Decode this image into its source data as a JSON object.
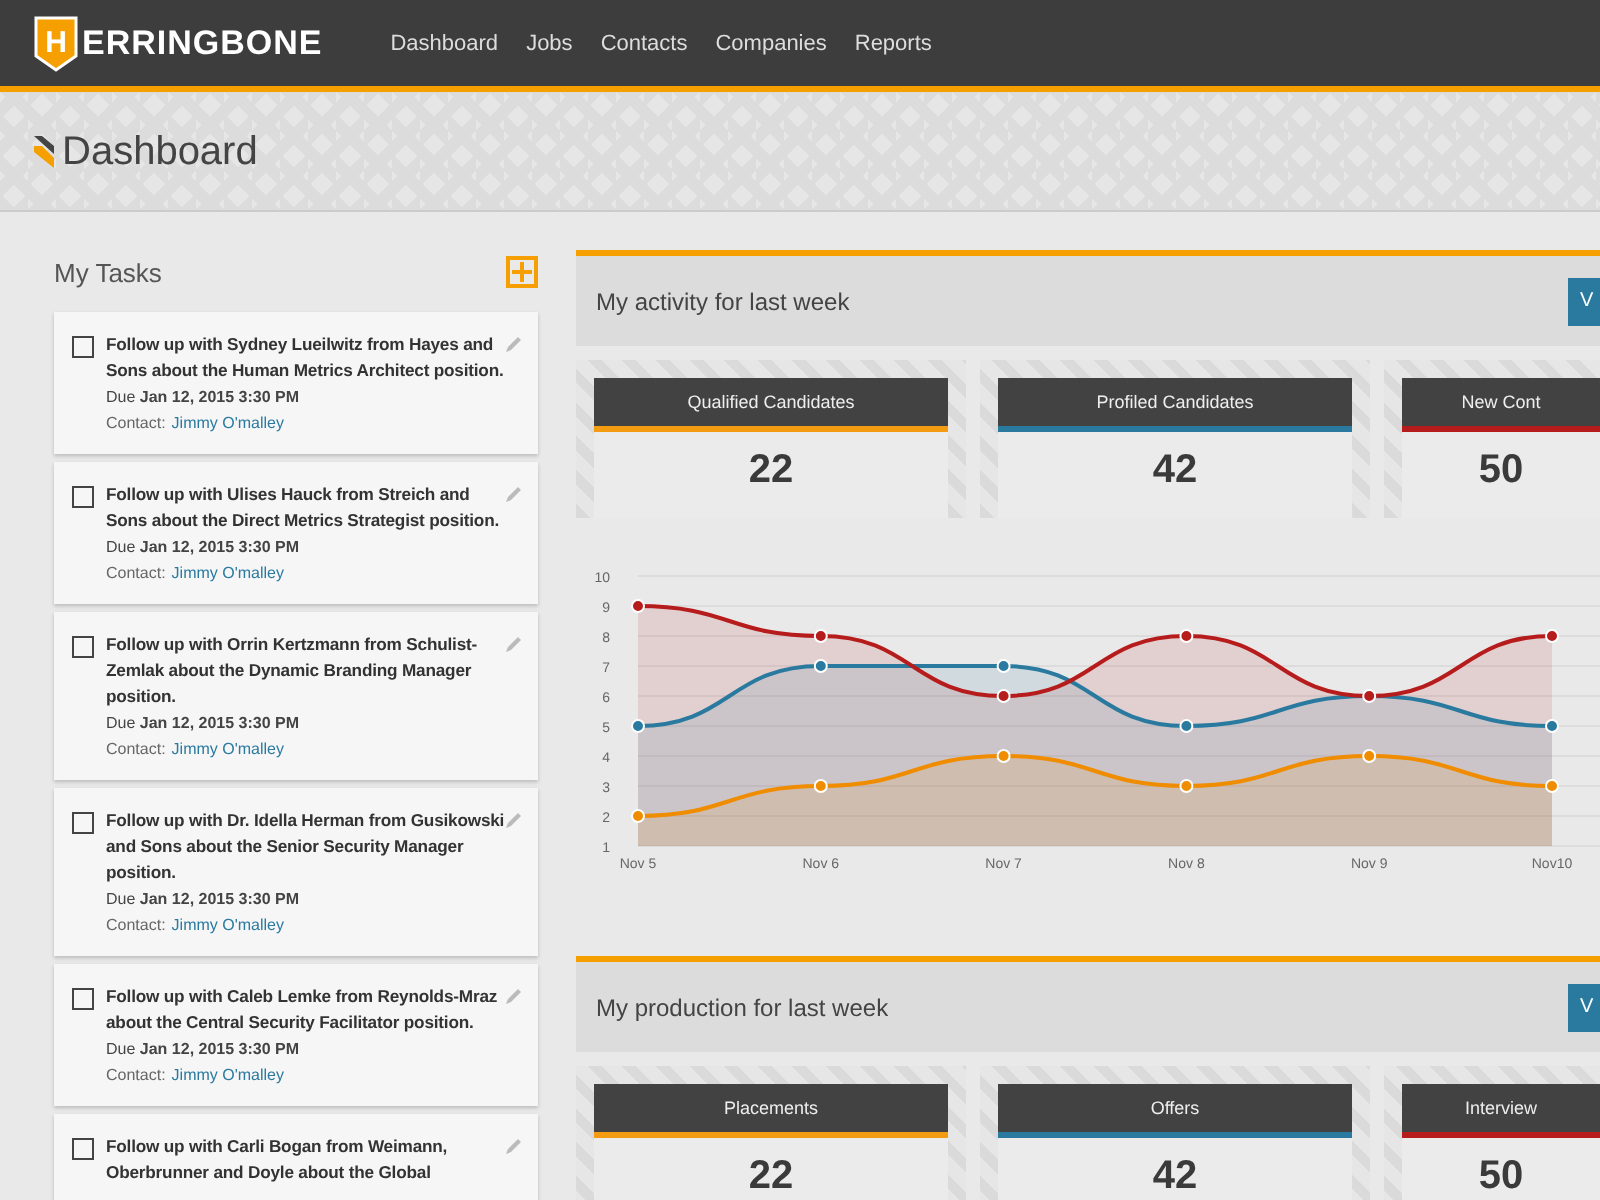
{
  "logo": {
    "mark": "H",
    "text": "ERRINGBONE"
  },
  "nav": [
    {
      "label": "Dashboard"
    },
    {
      "label": "Jobs"
    },
    {
      "label": "Contacts"
    },
    {
      "label": "Companies"
    },
    {
      "label": "Reports"
    }
  ],
  "page_title": "Dashboard",
  "tasks_panel": {
    "title": "My Tasks",
    "tasks": [
      {
        "text": "Follow up with Sydney Lueilwitz from Hayes and Sons about the Human Metrics Architect position.",
        "due": "Due **Jan 12, 2015 3:30 PM**",
        "contact_label": "Contact:",
        "contact": "Jimmy O'malley",
        "checked": false
      },
      {
        "text": "Follow up with Ulises Hauck from Streich and Sons about the Direct Metrics Strategist position.",
        "due": "Due **Jan 12, 2015 3:30 PM**",
        "contact_label": "Contact:",
        "contact": "Jimmy O'malley",
        "checked": false
      },
      {
        "text": "Follow up with Orrin Kertzmann from Schulist-Zemlak about the Dynamic Branding Manager position.",
        "due": "Due **Jan 12, 2015 3:30 PM**",
        "contact_label": "Contact:",
        "contact": "Jimmy O'malley",
        "checked": false
      },
      {
        "text": "Follow up with Dr. Idella Herman from Gusikowski and Sons about the Senior Security Manager position.",
        "due": "Due **Jan 12, 2015 3:30 PM**",
        "contact_label": "Contact:",
        "contact": "Jimmy O'malley",
        "checked": false
      },
      {
        "text": "Follow up with Caleb Lemke from Reynolds-Mraz about the Central Security Facilitator position.",
        "due": "Due **Jan 12, 2015 3:30 PM**",
        "contact_label": "Contact:",
        "contact": "Jimmy O'malley",
        "checked": false
      },
      {
        "text": "Follow up with Carli Bogan from Weimann, Oberbrunner and Doyle about the Global",
        "checked": false
      }
    ]
  },
  "panels": [
    {
      "title": "My activity for last week",
      "button": "V",
      "stats": [
        {
          "label": "Qualified Candidates",
          "value": "22",
          "color": "#f39c12"
        },
        {
          "label": "Profiled Candidates",
          "value": "42",
          "color": "#2a7aa0"
        },
        {
          "label": "New Cont",
          "value": "50",
          "color": "#b71c1c"
        }
      ],
      "chart_data": {
        "type": "area",
        "grid": true,
        "categories": [
          "Nov 5",
          "Nov 6",
          "Nov 7",
          "Nov 8",
          "Nov 9",
          "Nov10"
        ],
        "ylim": [
          1,
          10
        ],
        "yticks": [
          1,
          2,
          3,
          4,
          5,
          6,
          7,
          8,
          9,
          10
        ],
        "series": [
          {
            "color": "#b71c1c",
            "values": [
              9,
              8,
              6,
              8,
              6,
              8
            ]
          },
          {
            "color": "#2a7aa0",
            "values": [
              5,
              7,
              7,
              5,
              6,
              5
            ]
          },
          {
            "color": "#f08c00",
            "values": [
              2,
              3,
              4,
              3,
              4,
              3
            ]
          }
        ]
      }
    },
    {
      "title": "My production for last week",
      "button": "V",
      "stats": [
        {
          "label": "Placements",
          "value": "22",
          "color": "#f39c12"
        },
        {
          "label": "Offers",
          "value": "42",
          "color": "#2a7aa0"
        },
        {
          "label": "Interview",
          "value": "50",
          "color": "#b71c1c"
        }
      ]
    }
  ]
}
